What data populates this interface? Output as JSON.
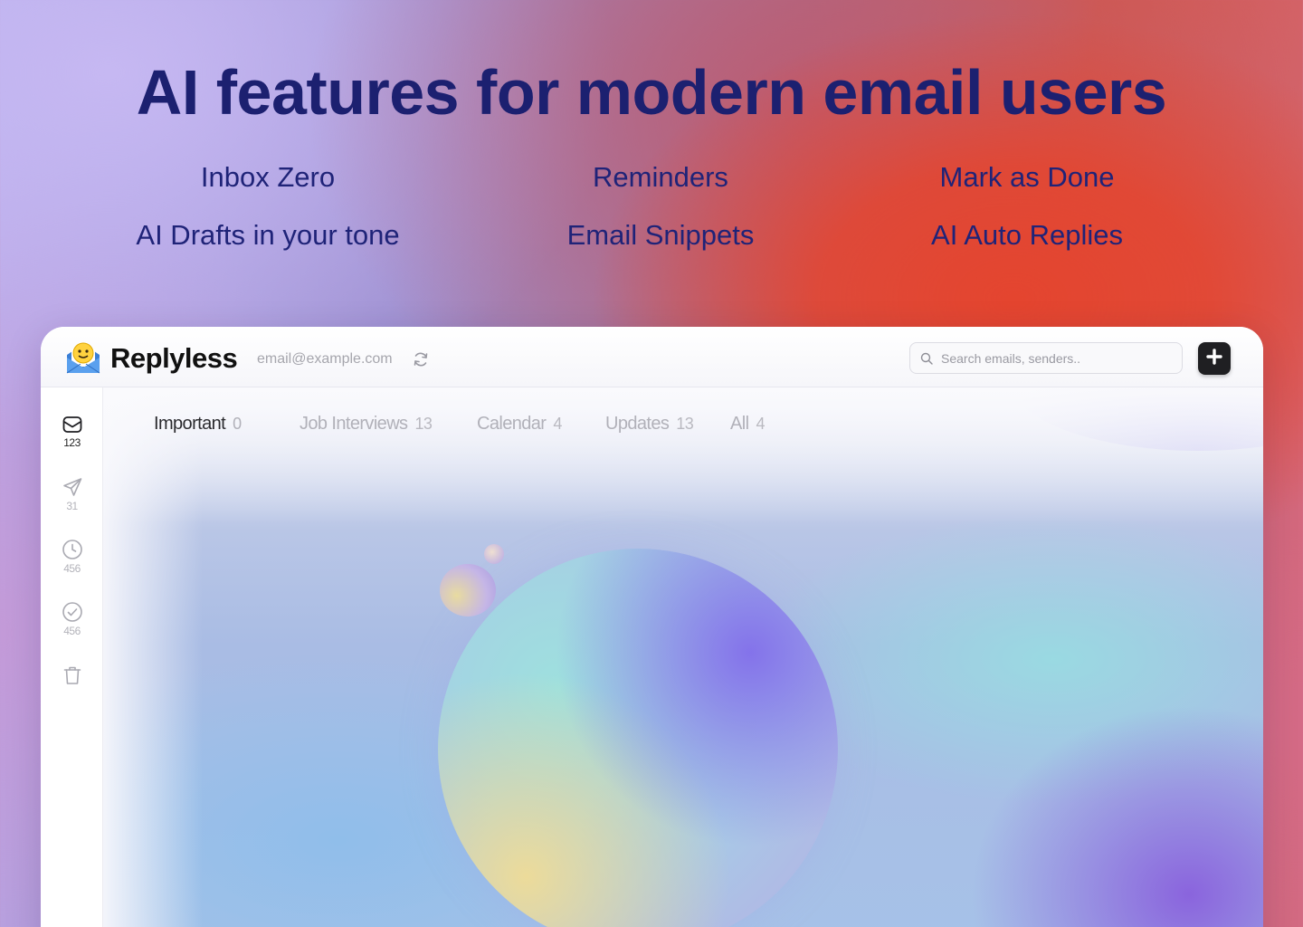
{
  "hero": {
    "title": "AI features for modern email users",
    "features": [
      "Inbox Zero",
      "Reminders",
      "Mark as Done",
      "AI Drafts in your tone",
      "Email Snippets",
      "AI Auto Replies"
    ]
  },
  "app": {
    "brand": "Replyless",
    "account_email": "email@example.com",
    "search": {
      "placeholder": "Search emails, senders.."
    },
    "icons": {
      "logo": "envelope-face-icon",
      "refresh": "refresh-icon",
      "search": "search-icon",
      "compose": "plus-icon"
    },
    "sidebar": [
      {
        "icon": "inbox-icon",
        "count": "123",
        "active": true
      },
      {
        "icon": "send-icon",
        "count": "31",
        "active": false
      },
      {
        "icon": "clock-icon",
        "count": "456",
        "active": false
      },
      {
        "icon": "check-circle-icon",
        "count": "456",
        "active": false
      },
      {
        "icon": "trash-icon",
        "count": "",
        "active": false
      }
    ],
    "tabs": [
      {
        "label": "Important",
        "count": "0",
        "active": true
      },
      {
        "label": "Job Interviews",
        "count": "13",
        "active": false
      },
      {
        "label": "Calendar",
        "count": "4",
        "active": false
      },
      {
        "label": "Updates",
        "count": "13",
        "active": false
      },
      {
        "label": "All",
        "count": "4",
        "active": false
      }
    ]
  },
  "colors": {
    "headline": "#1c2070",
    "compose_button": "#1f1f22",
    "active_tab": "#2a2a2e",
    "inactive_tab": "#b1b1b9"
  }
}
